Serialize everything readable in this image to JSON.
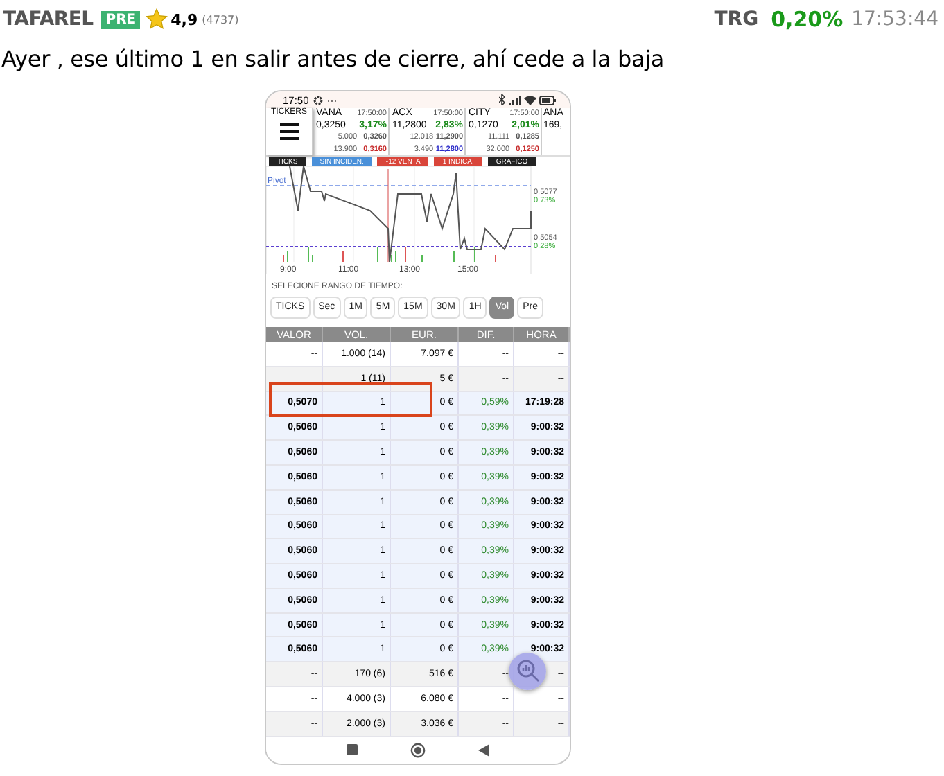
{
  "post": {
    "user": "TAFAREL",
    "badge": "PRE",
    "rating": "4,9",
    "rating_count": "(4737)",
    "ticker": "TRG",
    "change": "0,20%",
    "time": "17:53:44",
    "text": "Ayer , ese último 1 en salir antes de cierre, ahí cede a la baja"
  },
  "phone": {
    "status_time": "17:50",
    "status_more": "···",
    "tickers_label": "TICKERS",
    "tickers": [
      {
        "name": "VANA",
        "time": "17:50:00",
        "price": "0,3250",
        "change": "3,17%",
        "bid_qty": "5.000",
        "bid": "0,3260",
        "ask_qty": "13.900",
        "ask": {
          "text": "0,3160",
          "color": "#c62828"
        }
      },
      {
        "name": "ACX",
        "time": "17:50:00",
        "price": "11,2800",
        "change": "2,83%",
        "bid_qty": "12.018",
        "bid": "11,2900",
        "ask_qty": "3.490",
        "ask": {
          "text": "11,2800",
          "color": "#2a2ac8"
        }
      },
      {
        "name": "CITY",
        "time": "17:50:00",
        "price": "0,1270",
        "change": "2,01%",
        "bid_qty": "11.111",
        "bid": "0,1285",
        "ask_qty": "32.000",
        "ask": {
          "text": "0,1250",
          "color": "#c62828"
        }
      }
    ],
    "partial_ticker": {
      "name": "ANA",
      "price": "169,"
    },
    "filters": [
      {
        "label": "TICKS",
        "color": "#222222"
      },
      {
        "label": "SIN INCIDEN.",
        "color": "#4a90d9"
      },
      {
        "label": "-12 VENTA",
        "color": "#d9453a"
      },
      {
        "label": "1 INDICA.",
        "color": "#d9453a"
      },
      {
        "label": "GRAFICO",
        "color": "#222222"
      }
    ],
    "chart": {
      "pivot": "Pivot",
      "levels": [
        {
          "price": "0,5077",
          "pct": "0,73%"
        },
        {
          "price": "0,5054",
          "pct": "0,28%"
        }
      ],
      "x_labels": [
        "9:00",
        "11:00",
        "13:00",
        "15:00"
      ]
    },
    "range_label": "SELECIONE RANGO DE TIEMPO:",
    "ranges": [
      {
        "label": "TICKS",
        "selected": false
      },
      {
        "label": "Sec",
        "selected": false
      },
      {
        "label": "1M",
        "selected": false
      },
      {
        "label": "5M",
        "selected": false
      },
      {
        "label": "15M",
        "selected": false
      },
      {
        "label": "30M",
        "selected": false
      },
      {
        "label": "1H",
        "selected": false
      },
      {
        "label": "Vol",
        "selected": true
      },
      {
        "label": "Pre",
        "selected": false
      }
    ],
    "columns": [
      "VALOR",
      "VOL.",
      "EUR.",
      "DIF.",
      "HORA"
    ],
    "rows": [
      {
        "cells": [
          "--",
          "1.000 (14)",
          "7.097 €",
          "--",
          "--"
        ],
        "highlighted": false
      },
      {
        "cells": [
          "",
          "1 (11)",
          "5 €",
          "--",
          "--"
        ],
        "highlighted": false
      },
      {
        "cells": [
          "0,5070",
          "1",
          "0 €",
          "0,59%",
          "17:19:28"
        ],
        "highlighted": true
      },
      {
        "cells": [
          "0,5060",
          "1",
          "0 €",
          "0,39%",
          "9:00:32"
        ],
        "highlighted": true
      },
      {
        "cells": [
          "0,5060",
          "1",
          "0 €",
          "0,39%",
          "9:00:32"
        ],
        "highlighted": true
      },
      {
        "cells": [
          "0,5060",
          "1",
          "0 €",
          "0,39%",
          "9:00:32"
        ],
        "highlighted": true
      },
      {
        "cells": [
          "0,5060",
          "1",
          "0 €",
          "0,39%",
          "9:00:32"
        ],
        "highlighted": true
      },
      {
        "cells": [
          "0,5060",
          "1",
          "0 €",
          "0,39%",
          "9:00:32"
        ],
        "highlighted": true
      },
      {
        "cells": [
          "0,5060",
          "1",
          "0 €",
          "0,39%",
          "9:00:32"
        ],
        "highlighted": true
      },
      {
        "cells": [
          "0,5060",
          "1",
          "0 €",
          "0,39%",
          "9:00:32"
        ],
        "highlighted": true
      },
      {
        "cells": [
          "0,5060",
          "1",
          "0 €",
          "0,39%",
          "9:00:32"
        ],
        "highlighted": true
      },
      {
        "cells": [
          "0,5060",
          "1",
          "0 €",
          "0,39%",
          "9:00:32"
        ],
        "highlighted": true
      },
      {
        "cells": [
          "0,5060",
          "1",
          "0 €",
          "0,39%",
          "9:00:32"
        ],
        "highlighted": true
      },
      {
        "cells": [
          "--",
          "170 (6)",
          "516 €",
          "--",
          "--"
        ],
        "highlighted": false
      },
      {
        "cells": [
          "--",
          "4.000 (3)",
          "6.080 €",
          "--",
          "--"
        ],
        "highlighted": false
      },
      {
        "cells": [
          "--",
          "2.000 (3)",
          "3.036 €",
          "--",
          "--"
        ],
        "highlighted": false
      }
    ]
  }
}
